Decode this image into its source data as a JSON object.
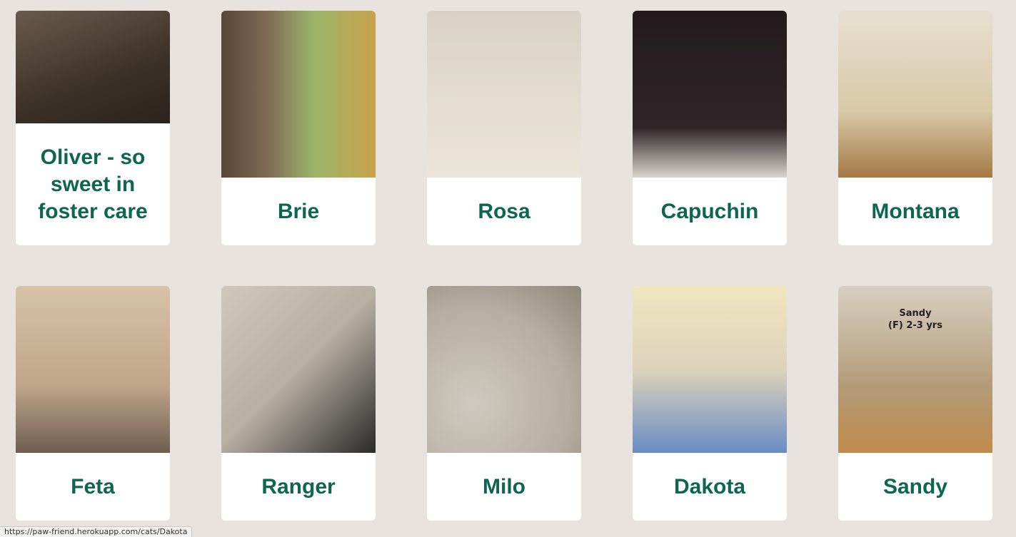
{
  "cats": {
    "row1": [
      {
        "name": "Oliver - so sweet in foster care"
      },
      {
        "name": "Brie"
      },
      {
        "name": "Rosa"
      },
      {
        "name": "Capuchin"
      },
      {
        "name": "Montana"
      }
    ],
    "row2": [
      {
        "name": "Feta"
      },
      {
        "name": "Ranger"
      },
      {
        "name": "Milo"
      },
      {
        "name": "Dakota"
      },
      {
        "name": "Sandy",
        "photo_caption_line1": "Sandy",
        "photo_caption_line2": "(F) 2-3 yrs"
      }
    ]
  },
  "status_bar": {
    "url": "https://paw-friend.herokuapp.com/cats/Dakota"
  },
  "colors": {
    "background": "#e8e3df",
    "card": "#ffffff",
    "name_text": "#0e6650"
  }
}
